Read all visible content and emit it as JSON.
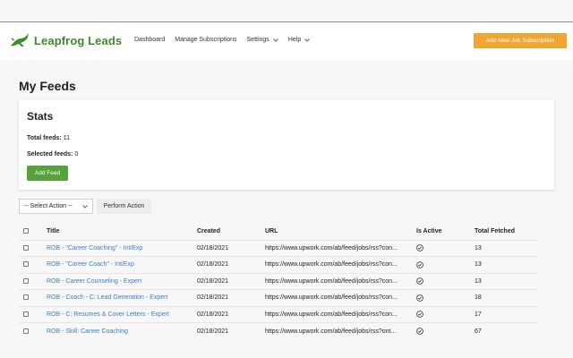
{
  "brand": {
    "name": "Leapfrog Leads"
  },
  "nav": {
    "items": [
      {
        "label": "Dashboard"
      },
      {
        "label": "Manage Subscriptions"
      },
      {
        "label": "Settings"
      },
      {
        "label": "Help"
      }
    ],
    "add_subscription_label": "Add New Job Subscription"
  },
  "page": {
    "title": "My Feeds"
  },
  "stats": {
    "title": "Stats",
    "total_label": "Total feeds:",
    "total_value": "11",
    "selected_label": "Selected feeds:",
    "selected_value": "0",
    "add_feed_label": "Add Feed"
  },
  "actions": {
    "select_value": "-- Select Action --",
    "perform_label": "Perform Action"
  },
  "table": {
    "headers": [
      "Title",
      "Created",
      "URL",
      "Is Active",
      "Total Fetched"
    ],
    "rows": [
      {
        "title": "ROB - \"Career Coaching\" - Int/Exp",
        "created": "02/18/2021",
        "url": "https://www.upwork.com/ab/feed/jobs/rss?con...",
        "fetched": "13"
      },
      {
        "title": "ROB - \"Career Coach\" - Int/Exp",
        "created": "02/18/2021",
        "url": "https://www.upwork.com/ab/feed/jobs/rss?con...",
        "fetched": "13"
      },
      {
        "title": "ROB - Career Counseling - Expert",
        "created": "02/18/2021",
        "url": "https://www.upwork.com/ab/feed/jobs/rss?con...",
        "fetched": "13"
      },
      {
        "title": "ROB - Coach - C: Lead Generation - Expert",
        "created": "02/18/2021",
        "url": "https://www.upwork.com/ab/feed/jobs/rss?con...",
        "fetched": "18"
      },
      {
        "title": "ROB - C: Resumes & Cover Letters - Expert",
        "created": "02/18/2021",
        "url": "https://www.upwork.com/ab/feed/jobs/rss?con...",
        "fetched": "17"
      },
      {
        "title": "ROB - Skill: Career Coaching",
        "created": "02/18/2021",
        "url": "https://www.upwork.com/ab/feed/jobs/rss?ont...",
        "fetched": "67"
      }
    ]
  },
  "colors": {
    "brand_green": "#3f8a2a",
    "accent_orange": "#f2a533",
    "button_green": "#57a13a",
    "link_blue": "#3f7fbf"
  },
  "icons": {
    "logo": "frog-icon",
    "active": "check-circle-icon",
    "dropdown": "chevron-down-icon"
  }
}
